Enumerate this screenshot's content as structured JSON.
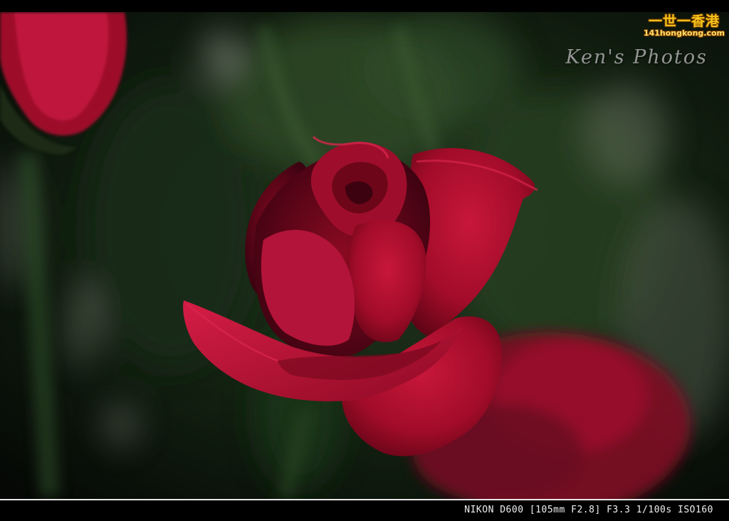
{
  "watermark": {
    "text": "Ken's Photos"
  },
  "site_logo": {
    "chinese": "一世一香港",
    "url": "141hongkong.com"
  },
  "exif": {
    "text": "NIKON D600 [105mm F2.8] F3.3 1/100s ISO160"
  },
  "colors": {
    "background": "#000000",
    "rose": "#b0102e",
    "foliage": "#1f3a1c",
    "exif_text": "#f0f0f0",
    "logo_gold": "#f7c31a"
  }
}
